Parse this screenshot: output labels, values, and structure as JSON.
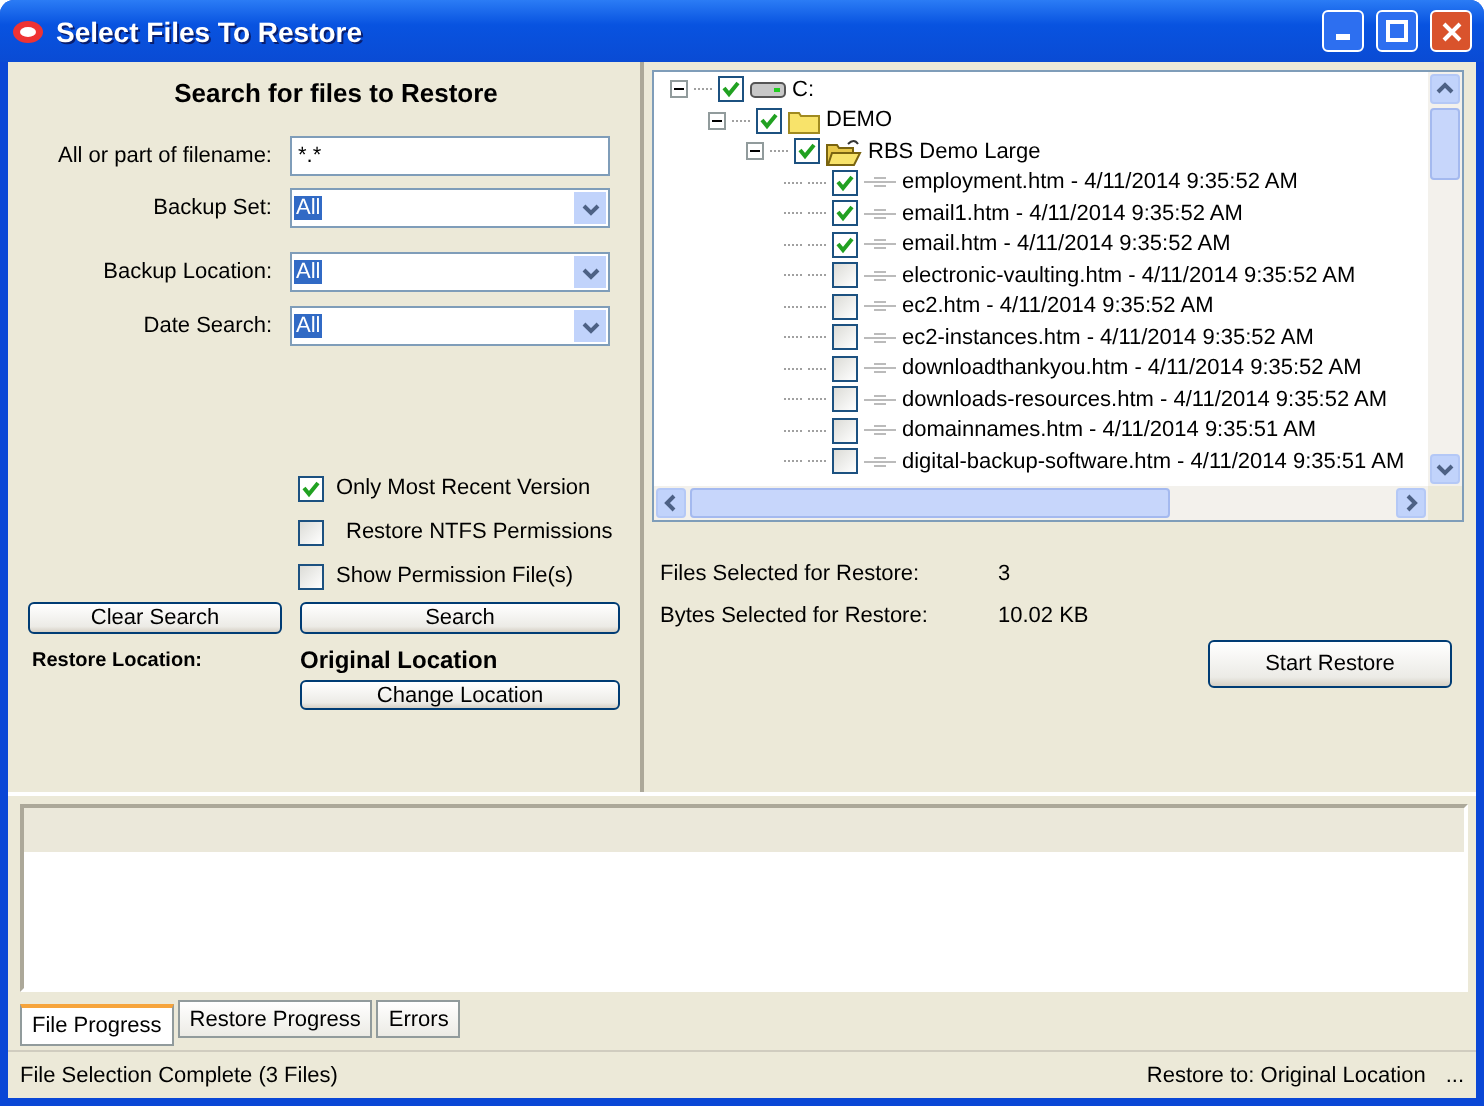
{
  "window": {
    "title": "Select Files To Restore"
  },
  "search": {
    "heading": "Search for files to Restore",
    "fields": [
      {
        "kind": "text",
        "label": "All or part of filename:",
        "value": "*.*"
      },
      {
        "kind": "dropdown",
        "label": "Backup Set:",
        "value": "All"
      },
      {
        "kind": "dropdown",
        "label": "Backup Location:",
        "value": "All"
      },
      {
        "kind": "dropdown",
        "label": "Date Search:",
        "value": "All"
      }
    ],
    "options": [
      {
        "label": "Only Most Recent Version",
        "checked": true
      },
      {
        "label": "Restore NTFS Permissions",
        "checked": false
      },
      {
        "label": "Show Permission File(s)",
        "checked": false
      }
    ],
    "clear_button": "Clear Search",
    "search_button": "Search",
    "restore_location_label": "Restore Location:",
    "restore_location_value": "Original Location",
    "change_button": "Change Location"
  },
  "tree": [
    {
      "kind": "drive",
      "label": "C:",
      "checked": true,
      "expanded": true,
      "children": [
        {
          "kind": "folder",
          "label": "DEMO",
          "checked": true,
          "expanded": true,
          "children": [
            {
              "kind": "open-folder",
              "label": "RBS Demo Large",
              "checked": true,
              "expanded": true,
              "children": [
                {
                  "kind": "file",
                  "label": "employment.htm - 4/11/2014 9:35:52 AM",
                  "checked": true
                },
                {
                  "kind": "file",
                  "label": "email1.htm - 4/11/2014 9:35:52 AM",
                  "checked": true
                },
                {
                  "kind": "file",
                  "label": "email.htm - 4/11/2014 9:35:52 AM",
                  "checked": true
                },
                {
                  "kind": "file",
                  "label": "electronic-vaulting.htm - 4/11/2014 9:35:52 AM",
                  "checked": false
                },
                {
                  "kind": "file",
                  "label": "ec2.htm - 4/11/2014 9:35:52 AM",
                  "checked": false
                },
                {
                  "kind": "file",
                  "label": "ec2-instances.htm - 4/11/2014 9:35:52 AM",
                  "checked": false
                },
                {
                  "kind": "file",
                  "label": "downloadthankyou.htm - 4/11/2014 9:35:52 AM",
                  "checked": false
                },
                {
                  "kind": "file",
                  "label": "downloads-resources.htm - 4/11/2014 9:35:52 AM",
                  "checked": false
                },
                {
                  "kind": "file",
                  "label": "domainnames.htm - 4/11/2014 9:35:51 AM",
                  "checked": false
                },
                {
                  "kind": "file",
                  "label": "digital-backup-software.htm - 4/11/2014 9:35:51 AM",
                  "checked": false
                }
              ]
            }
          ]
        }
      ]
    }
  ],
  "summary": [
    {
      "label": "Files Selected for Restore:",
      "value": "3"
    },
    {
      "label": "Bytes Selected for Restore:",
      "value": "10.02 KB"
    }
  ],
  "start_button": "Start Restore",
  "tabs": [
    {
      "label": "File Progress",
      "selected": true
    },
    {
      "label": "Restore Progress",
      "selected": false
    },
    {
      "label": "Errors",
      "selected": false
    }
  ],
  "status_bar": {
    "left": "File Selection Complete (3 Files)",
    "right": "Restore to: Original Location",
    "extra": "..."
  }
}
